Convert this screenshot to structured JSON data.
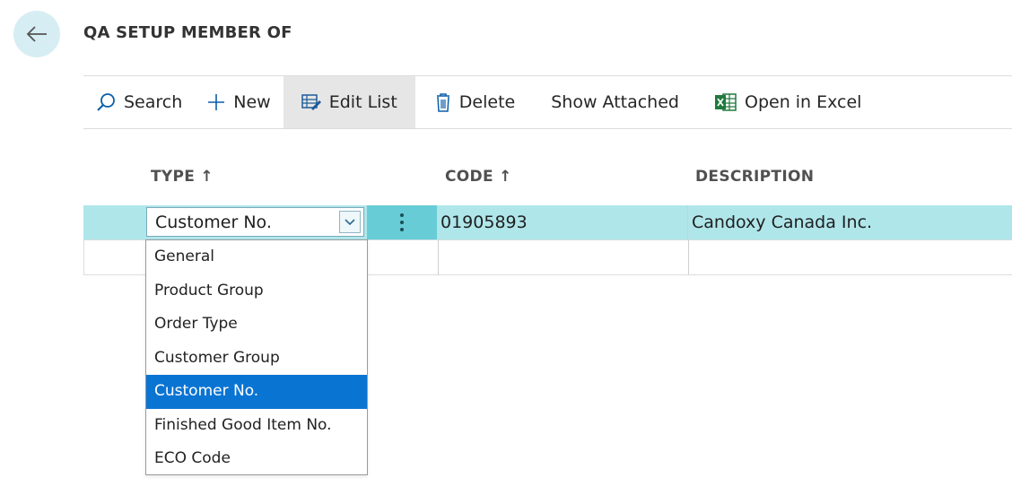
{
  "page": {
    "title": "QA SETUP MEMBER OF"
  },
  "actions": {
    "search": "Search",
    "new": "New",
    "edit_list": "Edit List",
    "delete": "Delete",
    "show_attached": "Show Attached",
    "open_in_excel": "Open in Excel"
  },
  "columns": {
    "type": "TYPE ↑",
    "code": "CODE ↑",
    "description": "DESCRIPTION"
  },
  "rows": [
    {
      "type": "Customer No.",
      "code": "01905893",
      "description": "Candoxy Canada Inc."
    }
  ],
  "type_options": [
    "General",
    "Product Group",
    "Order Type",
    "Customer Group",
    "Customer No.",
    "Finished Good Item No.",
    "ECO Code"
  ],
  "selected_type_option": "Customer No.",
  "colors": {
    "selected_row": "#afe6ea",
    "more_button": "#67ccd6",
    "selected_option": "#0a74d3",
    "back_button": "#d6eef3"
  }
}
